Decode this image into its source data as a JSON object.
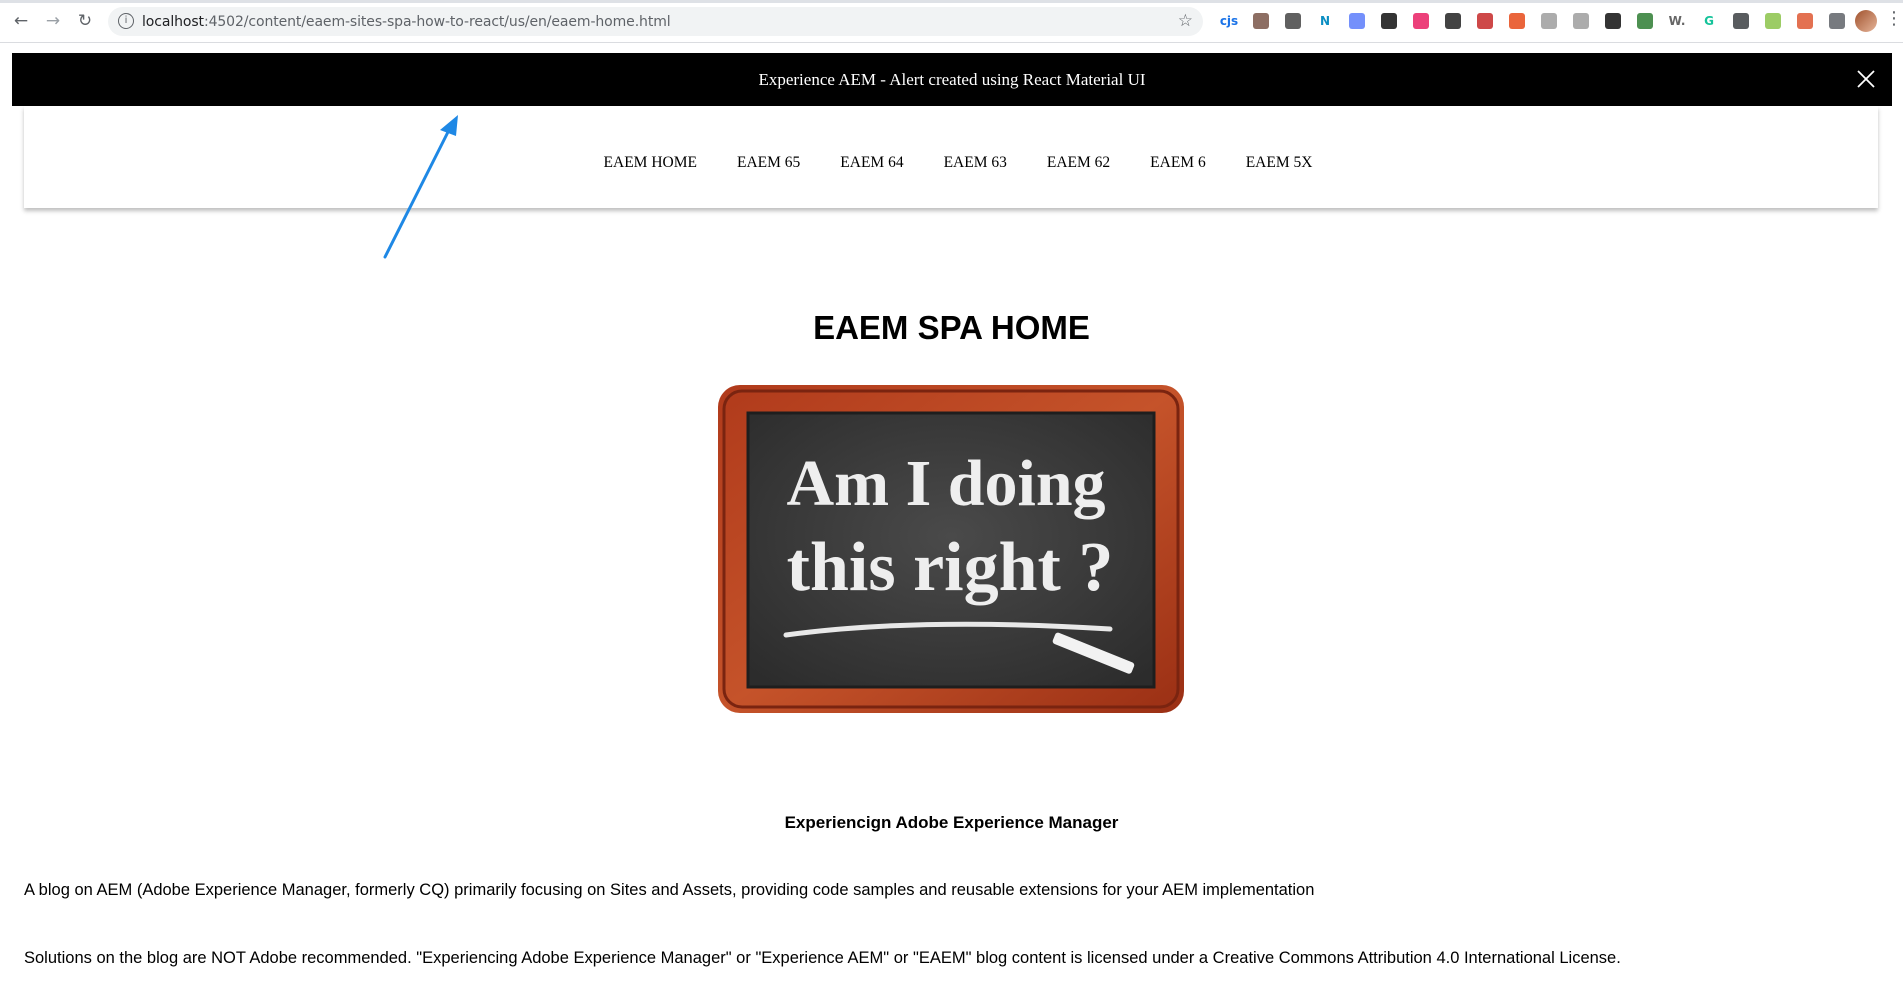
{
  "browser": {
    "url_host": "localhost",
    "url_path": ":4502/content/eaem-sites-spa-how-to-react/us/en/eaem-home.html",
    "extensions": [
      {
        "icon": "cjs-icon",
        "text": "cjs",
        "color": "#1a73e8"
      },
      {
        "icon": "pen-icon",
        "text": "",
        "color": "#795548"
      },
      {
        "icon": "circle-icon",
        "text": "",
        "color": "#444444"
      },
      {
        "icon": "n-icon",
        "text": "N",
        "color": "#0b8ec2"
      },
      {
        "icon": "feather-icon",
        "text": "",
        "color": "#5c7cfa"
      },
      {
        "icon": "hat-icon",
        "text": "",
        "color": "#111111"
      },
      {
        "icon": "ring-icon",
        "text": "",
        "color": "#e91e63"
      },
      {
        "icon": "drive-icon",
        "text": "",
        "color": "#222222"
      },
      {
        "icon": "red-square-icon",
        "text": "",
        "color": "#c62828"
      },
      {
        "icon": "target-icon",
        "text": "",
        "color": "#e64a19"
      },
      {
        "icon": "check-icon",
        "text": "",
        "color": "#9e9e9e"
      },
      {
        "icon": "box-icon",
        "text": "",
        "color": "#9e9e9e"
      },
      {
        "icon": "grid-icon",
        "text": "",
        "color": "#111111"
      },
      {
        "icon": "leaf-icon",
        "text": "",
        "color": "#2e7d32"
      },
      {
        "icon": "w-icon",
        "text": "W.",
        "color": "#666666"
      },
      {
        "icon": "g-icon",
        "text": "G",
        "color": "#15c39a"
      },
      {
        "icon": "globe-icon",
        "text": "",
        "color": "#3c4043"
      },
      {
        "icon": "bulb-icon",
        "text": "",
        "color": "#8bc34a"
      },
      {
        "icon": "duck-icon",
        "text": "",
        "color": "#de5833"
      },
      {
        "icon": "puzzle-icon",
        "text": "",
        "color": "#5f6368"
      }
    ]
  },
  "alert": {
    "text": "Experience AEM - Alert created using React Material UI"
  },
  "nav": {
    "items": [
      "EAEM HOME",
      "EAEM 65",
      "EAEM 64",
      "EAEM 63",
      "EAEM 62",
      "EAEM 6",
      "EAEM 5X"
    ]
  },
  "main": {
    "title": "EAEM SPA HOME",
    "chalkboard_line1": "Am I doing",
    "chalkboard_line2": "this right ?",
    "subtitle": "Experiencign Adobe Experience Manager",
    "para1": "A blog on AEM (Adobe Experience Manager, formerly CQ) primarily focusing on Sites and Assets, providing code samples and reusable extensions for your AEM implementation",
    "para2": "Solutions on the blog are NOT Adobe recommended. \"Experiencing Adobe Experience Manager\" or \"Experience AEM\" or \"EAEM\" blog content is licensed under a Creative Commons Attribution 4.0 International License."
  },
  "colors": {
    "alert_bg": "#000000",
    "annotation_arrow": "#1e88e5"
  }
}
